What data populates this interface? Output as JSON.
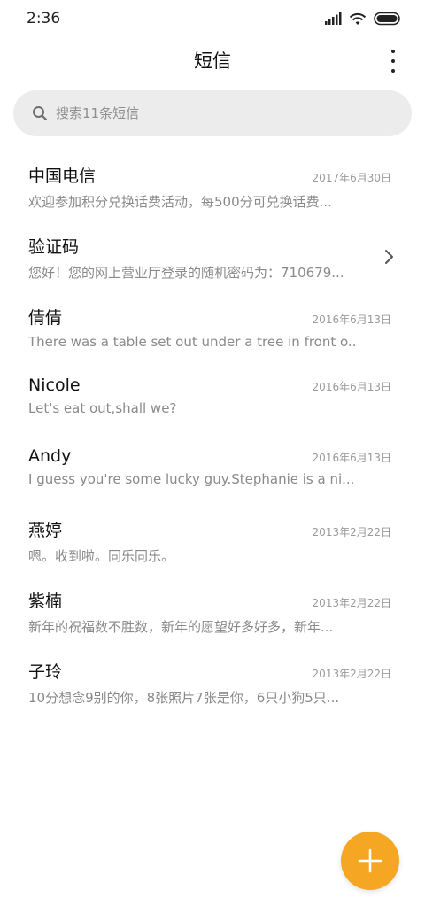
{
  "status_bar": {
    "time": "2:36"
  },
  "header": {
    "title": "短信"
  },
  "search": {
    "placeholder": "搜索11条短信"
  },
  "messages": [
    {
      "name": "中国电信",
      "date": "2017年6月30日",
      "preview": "欢迎参加积分兑换话费活动，每500分可兑换话费..."
    },
    {
      "name": "验证码",
      "date": "",
      "preview": "您好！您的网上营业厅登录的随机密码为：710679..."
    },
    {
      "name": "倩倩",
      "date": "2016年6月13日",
      "preview": "There was a table set out under a tree in front o..."
    },
    {
      "name": "Nicole",
      "date": "2016年6月13日",
      "preview": "Let's eat out,shall we?"
    },
    {
      "name": "Andy",
      "date": "2016年6月13日",
      "preview": "I guess you're some lucky guy.Stephanie is a ni..."
    },
    {
      "name": "燕婷",
      "date": "2013年2月22日",
      "preview": "嗯。收到啦。同乐同乐。"
    },
    {
      "name": "紫楠",
      "date": "2013年2月22日",
      "preview": "新年的祝福数不胜数，新年的愿望好多好多，新年..."
    },
    {
      "name": "子玲",
      "date": "2013年2月22日",
      "preview": "10分想念9别的你，8张照片7张是你，6只小狗5只..."
    }
  ],
  "colors": {
    "accent": "#f5a623",
    "search_bg": "#ececec",
    "secondary_text": "#8a8a8a"
  },
  "icons": [
    "signal-icon",
    "wifi-icon",
    "battery-icon",
    "more-vert-icon",
    "search-icon",
    "chevron-right-icon",
    "plus-icon"
  ]
}
